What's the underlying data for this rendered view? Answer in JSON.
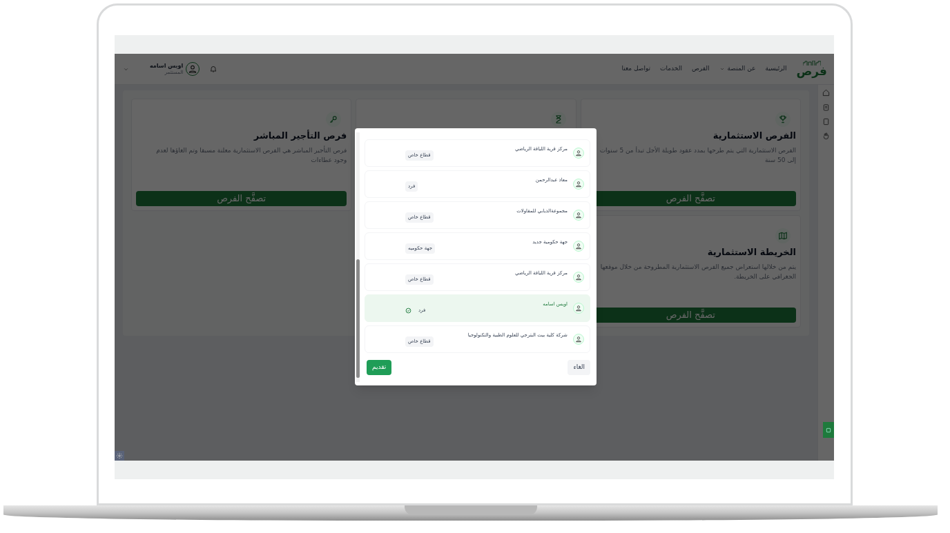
{
  "header": {
    "logo": "فرص",
    "nav": [
      {
        "label": "الرئيسية",
        "dropdown": false
      },
      {
        "label": "عن المنصة",
        "dropdown": true
      },
      {
        "label": "الفرص",
        "dropdown": false
      },
      {
        "label": "الخدمات",
        "dropdown": false
      },
      {
        "label": "تواصل معنا",
        "dropdown": false
      }
    ],
    "user": {
      "name": "اويس اسامه",
      "role": "المستثمر"
    }
  },
  "cards": [
    {
      "kind": "trophy",
      "title": "الفرص الاستثمارية",
      "description": "الفرص الاستثمارية التي يتم طرحها بمدد عقود طويلة الأجل تبدأ من 5 سنوات إلى 50 سنة",
      "button": "تصفَّح الفرص"
    },
    {
      "kind": "hourglass"
    },
    {
      "kind": "key",
      "title": "فرص التأجير المباشر",
      "description": "فرص التأجير المباشر هي الفرص الاستثمارية معلنة مسبقا وتم الغاؤها لعدم وجود عطاءات",
      "button": "تصفَّح الفرص"
    },
    {
      "kind": "map",
      "title": "الخريطة الاستثمارية",
      "description": "يتم من خلالها استعراض جميع الفرص الاستثمارية المطروحة من خلال موقعها الجغرافي على الخريطة.",
      "button": "تصفَّح الفرص"
    }
  ],
  "modal": {
    "accounts": [
      {
        "name": "مركز قرية اللياقة الرياضي",
        "type": "قطاع خاص",
        "selected": false
      },
      {
        "name": "معاذ عبدالرحمن",
        "type": "فرد",
        "selected": false
      },
      {
        "name": "مجموعةالذيابي للمقاولات",
        "type": "قطاع خاص",
        "selected": false
      },
      {
        "name": "جهة حكومية جديد",
        "type": "جهة حكوميه",
        "selected": false
      },
      {
        "name": "مركز قرية اللياقة الرياضي",
        "type": "قطاع خاص",
        "selected": false
      },
      {
        "name": "اويس اسامه",
        "type": "فرد",
        "selected": true
      },
      {
        "name": "شركة كلية بيت البترجي للعلوم الطبية والتكنولوجيا",
        "type": "قطاع خاص",
        "selected": false
      }
    ],
    "cancel": "الغاء",
    "submit": "تقديم"
  }
}
